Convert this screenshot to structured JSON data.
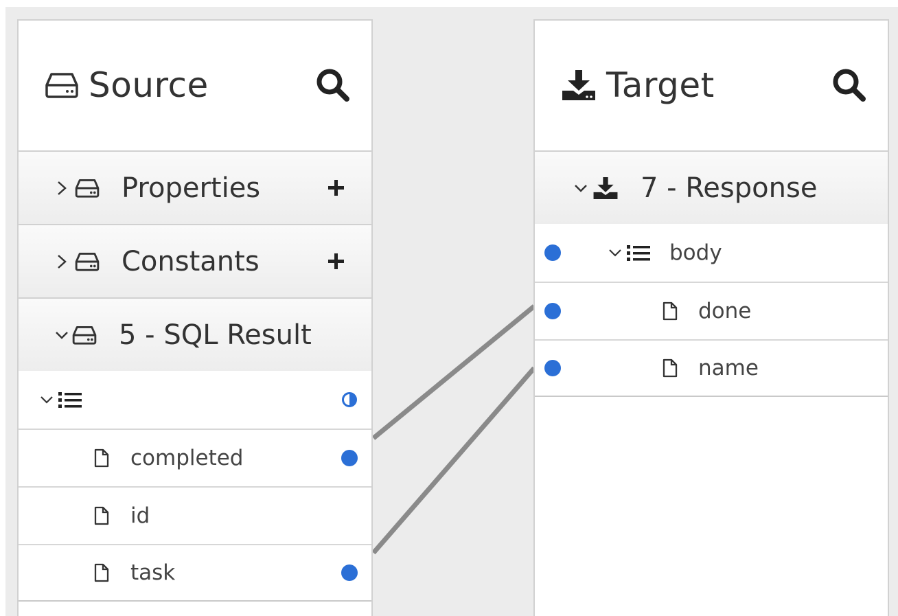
{
  "source": {
    "title": "Source",
    "sections": [
      {
        "name": "Properties",
        "expanded": false,
        "has_add": true
      },
      {
        "name": "Constants",
        "expanded": false,
        "has_add": true
      },
      {
        "name": "5 - SQL Result",
        "expanded": true,
        "has_add": false
      }
    ],
    "collection_row": {
      "label": "",
      "mapping_status": "partial"
    },
    "fields": [
      {
        "label": "completed",
        "mapped": true
      },
      {
        "label": "id",
        "mapped": false
      },
      {
        "label": "task",
        "mapped": true
      }
    ]
  },
  "target": {
    "title": "Target",
    "document": {
      "name": "7 - Response",
      "expanded": true
    },
    "collection": {
      "label": "body",
      "mapped": true
    },
    "fields": [
      {
        "label": "done",
        "mapped": true
      },
      {
        "label": "name",
        "mapped": true
      }
    ]
  },
  "mappings": [
    {
      "source": "completed",
      "target": "done"
    },
    {
      "source": "task",
      "target": "name"
    }
  ],
  "colors": {
    "mapped_dot": "#2b6fd6",
    "mapping_line": "#8a8a8a",
    "canvas_bg": "#ececec",
    "panel_border": "#d1d1d1"
  }
}
